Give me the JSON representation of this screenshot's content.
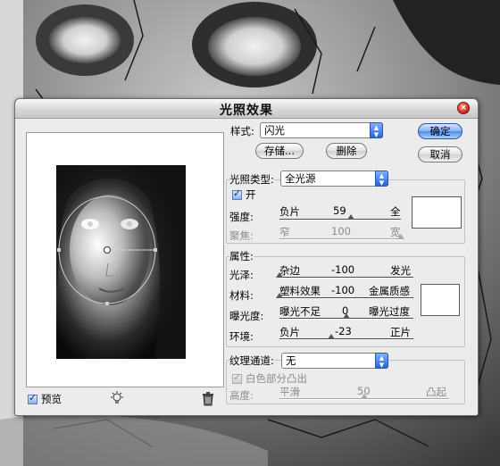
{
  "dialog": {
    "title": "光照效果",
    "close_glyph": "×",
    "style_label": "样式:",
    "style_value": "闪光",
    "save_button": "存储...",
    "delete_button": "删除",
    "ok_button": "确定",
    "cancel_button": "取消",
    "preview_label": "预览"
  },
  "light": {
    "type_label": "光照类型:",
    "type_value": "全光源",
    "on_label": "开",
    "intensity": {
      "label": "强度:",
      "left": "负片",
      "value": "59",
      "right": "全",
      "position": 0.59
    },
    "focus": {
      "label": "聚焦:",
      "left": "窄",
      "value": "100",
      "right": "宽",
      "position": 1.0
    }
  },
  "properties": {
    "group_label": "属性:",
    "gloss": {
      "label": "光泽:",
      "left": "杂边",
      "value": "-100",
      "right": "发光",
      "position": 0.0
    },
    "material": {
      "label": "材料:",
      "left": "塑料效果",
      "value": "-100",
      "right": "金属质感",
      "position": 0.0
    },
    "exposure": {
      "label": "曝光度:",
      "left": "曝光不足",
      "value": "0",
      "right": "曝光过度",
      "position": 0.5
    },
    "ambience": {
      "label": "环境:",
      "left": "负片",
      "value": "-23",
      "right": "正片",
      "position": 0.385
    }
  },
  "texture": {
    "channel_label": "纹理通道:",
    "channel_value": "无",
    "white_high_label": "白色部分凸出",
    "height": {
      "label": "高度:",
      "left": "平滑",
      "value": "50",
      "right": "凸起",
      "position": 0.5
    }
  },
  "colors": {
    "swatch": "#ffffff",
    "accent": "#2b63d6"
  }
}
